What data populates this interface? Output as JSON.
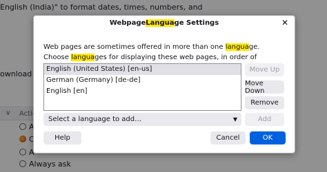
{
  "background": {
    "line_1": "English (India)\" to format dates, times, numbers, and",
    "line_2": "ownload from",
    "actions_header": "Actio",
    "rows": [
      {
        "label": "A",
        "icon": "circle-icon"
      },
      {
        "label": "C",
        "icon": "firefox-icon"
      },
      {
        "label": "A",
        "icon": "circle-icon"
      },
      {
        "label": "Always ask",
        "icon": "circle-icon"
      }
    ]
  },
  "dialog": {
    "title_before": "Webpage ",
    "title_highlight": "Langua",
    "title_after": "ge Settings",
    "description": {
      "part_1": "Web pages are sometimes offered in more than one ",
      "highlight_1": "langua",
      "part_2": "ge. Choose ",
      "highlight_2": "langua",
      "part_3": "ges for displaying these web pages, in order of preference"
    },
    "languages": [
      "English (United States) [en-us]",
      "German (Germany) [de-de]",
      "English [en]"
    ],
    "buttons": {
      "move_up": "Move Up",
      "move_down": "Move Down",
      "remove": "Remove",
      "add": "Add",
      "help": "Help",
      "cancel": "Cancel",
      "ok": "OK"
    },
    "select_placeholder": "Select a language to add…"
  },
  "colors": {
    "highlight": "#ffe900",
    "primary_button": "#0061e0"
  }
}
